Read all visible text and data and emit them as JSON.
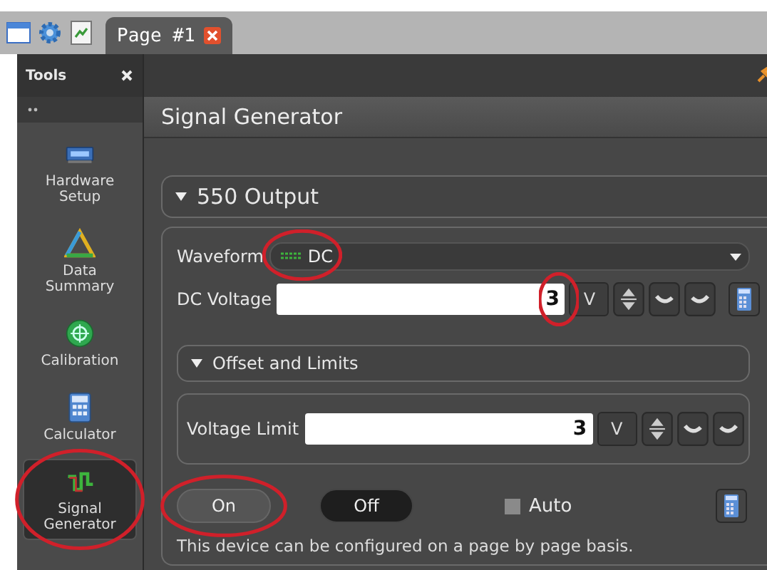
{
  "tabs": [
    {
      "label": "Page #1",
      "selected": true
    }
  ],
  "tools_panel": {
    "title": "Tools"
  },
  "sidebar": {
    "items": [
      {
        "lines": [
          "Hardware",
          "Setup"
        ],
        "selected": false
      },
      {
        "lines": [
          "Data",
          "Summary"
        ],
        "selected": false
      },
      {
        "lines": [
          "Calibration"
        ],
        "selected": false
      },
      {
        "lines": [
          "Calculator"
        ],
        "selected": false
      },
      {
        "lines": [
          "Signal",
          "Generator"
        ],
        "selected": true
      }
    ]
  },
  "panel": {
    "title": "Signal Generator"
  },
  "output_section": {
    "title": "550 Output",
    "expanded": true
  },
  "waveform": {
    "label": "Waveform",
    "value": "DC"
  },
  "dc_voltage": {
    "label": "DC Voltage",
    "value": "3",
    "unit": "V"
  },
  "offset_section": {
    "title": "Offset and Limits",
    "expanded": true
  },
  "voltage_limit": {
    "label": "Voltage Limit",
    "value": "3",
    "unit": "V"
  },
  "buttons": [
    {
      "label": "On",
      "selected": false
    },
    {
      "label": "Off",
      "selected": true
    }
  ],
  "auto": {
    "label": "Auto",
    "checked": false
  },
  "note": "This device can be configured on a page by page basis."
}
